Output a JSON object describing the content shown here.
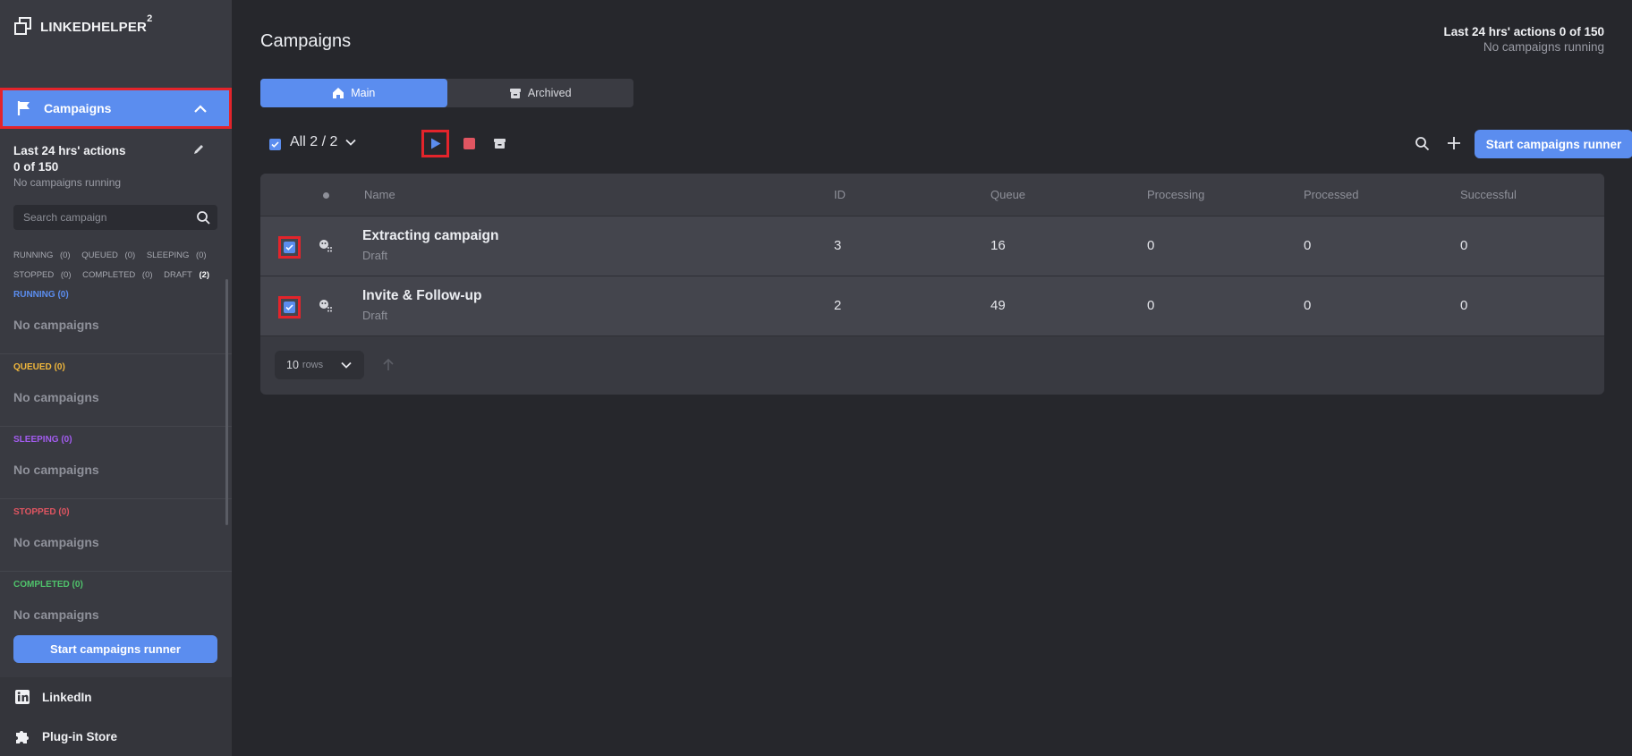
{
  "app": {
    "logo_text": "LINKEDHELPER",
    "logo_sup": "2"
  },
  "sidebar": {
    "section_label": "Campaigns",
    "actions_line1": "Last 24 hrs' actions",
    "actions_line2": "0 of 150",
    "running_status": "No campaigns running",
    "search_placeholder": "Search campaign",
    "filters": [
      {
        "label": "RUNNING",
        "count": "(0)"
      },
      {
        "label": "QUEUED",
        "count": "(0)"
      },
      {
        "label": "SLEEPING",
        "count": "(0)"
      },
      {
        "label": "STOPPED",
        "count": "(0)"
      },
      {
        "label": "COMPLETED",
        "count": "(0)"
      },
      {
        "label": "DRAFT",
        "count": "(2)"
      }
    ],
    "groups": [
      {
        "label": "RUNNING (0)",
        "empty": "No campaigns",
        "color": "#5b8def"
      },
      {
        "label": "QUEUED (0)",
        "empty": "No campaigns",
        "color": "#f0b73c"
      },
      {
        "label": "SLEEPING (0)",
        "empty": "No campaigns",
        "color": "#a35cf0"
      },
      {
        "label": "STOPPED (0)",
        "empty": "No campaigns",
        "color": "#e05561"
      },
      {
        "label": "COMPLETED (0)",
        "empty": "No campaigns",
        "color": "#4fc36b"
      }
    ],
    "runner_button": "Start campaigns runner",
    "links": {
      "linkedin": "LinkedIn",
      "plugin_store": "Plug-in Store"
    }
  },
  "header": {
    "title": "Campaigns",
    "actions_summary": "Last 24 hrs' actions 0 of 150",
    "running_status": "No campaigns running"
  },
  "tabs": {
    "main": "Main",
    "archived": "Archived"
  },
  "toolbar": {
    "selection": "All 2 / 2",
    "runner_button": "Start campaigns runner"
  },
  "table": {
    "headers": {
      "name": "Name",
      "id": "ID",
      "queue": "Queue",
      "processing": "Processing",
      "processed": "Processed",
      "successful": "Successful"
    },
    "rows": [
      {
        "name": "Extracting campaign",
        "status": "Draft",
        "id": "3",
        "queue": "16",
        "processing": "0",
        "processed": "0",
        "successful": "0"
      },
      {
        "name": "Invite & Follow-up",
        "status": "Draft",
        "id": "2",
        "queue": "49",
        "processing": "0",
        "processed": "0",
        "successful": "0"
      }
    ],
    "rows_per_page": "10",
    "rows_label": "rows"
  },
  "colors": {
    "accent": "#5b8def",
    "highlight": "#e3242b",
    "stop": "#e05561"
  }
}
